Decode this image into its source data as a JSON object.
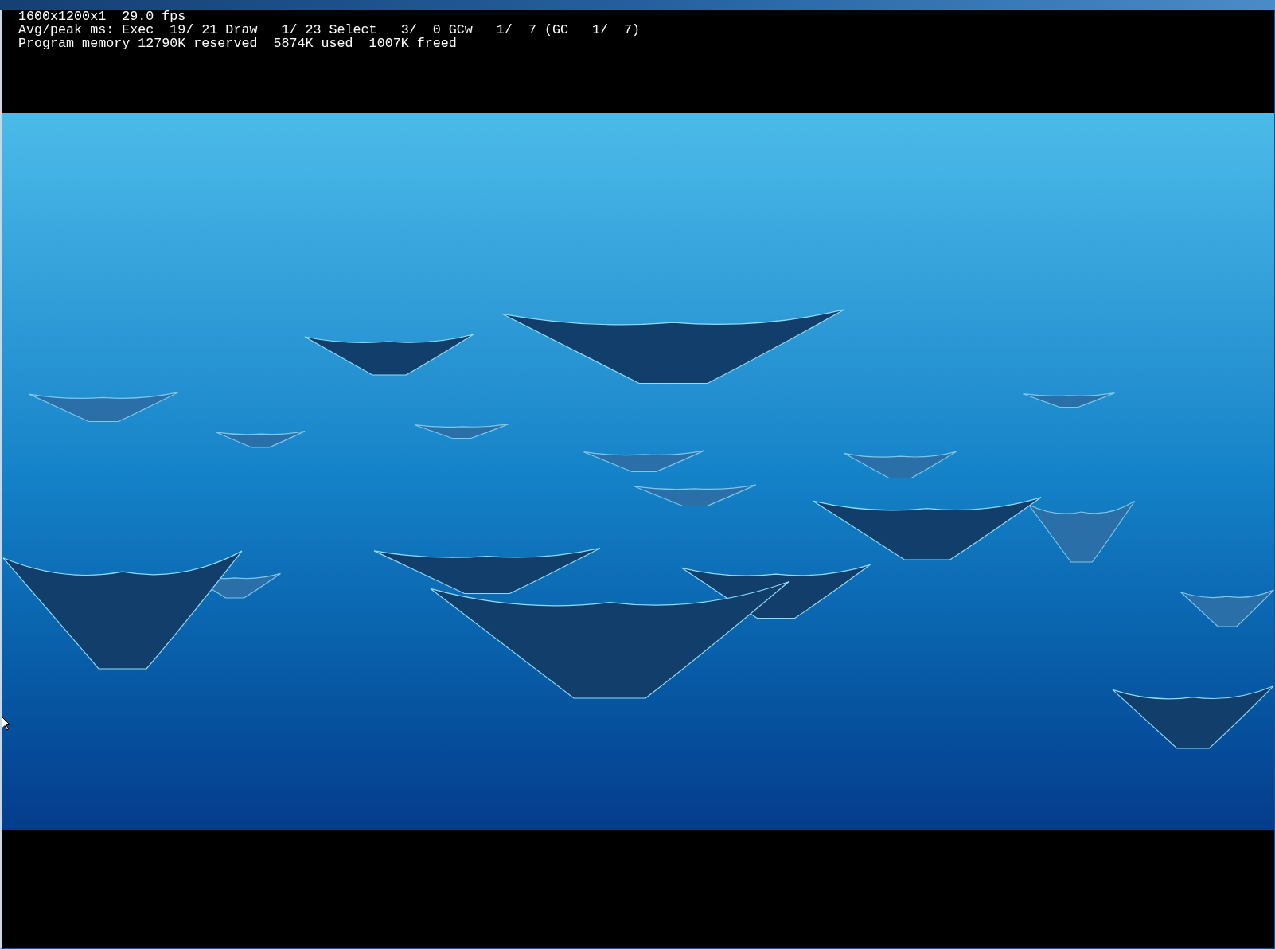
{
  "overlay": {
    "lines": [
      "1600x1200x1  29.0 fps",
      "Avg/peak ms: Exec  19/ 21 Draw   1/ 23 Select   3/  0 GCw   1/  7 (GC   1/  7)",
      "Program memory 12790K reserved  5874K used  1007K freed"
    ]
  }
}
